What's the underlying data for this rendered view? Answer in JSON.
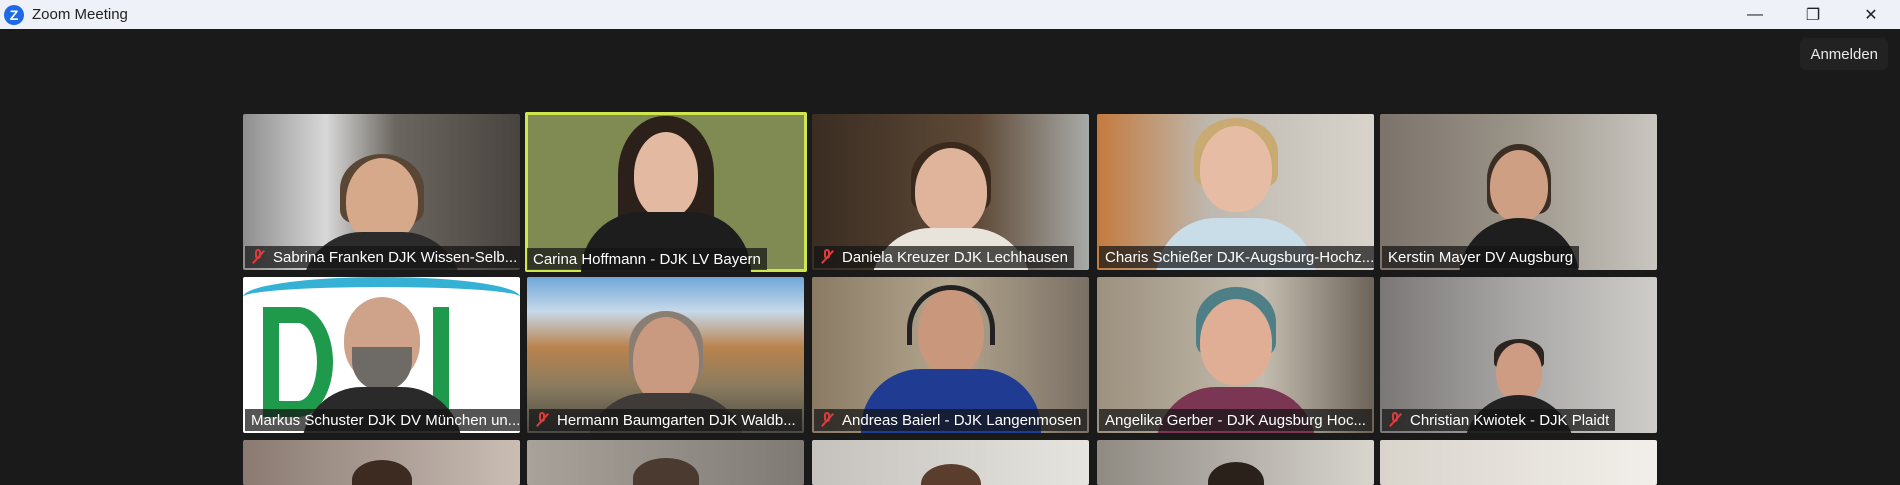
{
  "window": {
    "title": "Zoom Meeting",
    "signin_label": "Anmelden",
    "minimize_glyph": "—",
    "restore_glyph": "❐",
    "close_glyph": "✕"
  },
  "participants": [
    {
      "name": "Sabrina Franken DJK Wissen-Selb...",
      "muted": true
    },
    {
      "name": "Carina Hoffmann - DJK LV Bayern",
      "muted": false,
      "active_speaker": true
    },
    {
      "name": "Daniela Kreuzer DJK Lechhausen",
      "muted": true
    },
    {
      "name": "Charis Schießer DJK-Augsburg-Hochz...",
      "muted": false
    },
    {
      "name": "Kerstin Mayer DV Augsburg",
      "muted": false
    },
    {
      "name": "Markus Schuster DJK DV München un...",
      "muted": false
    },
    {
      "name": "Hermann Baumgarten DJK Waldb...",
      "muted": true
    },
    {
      "name": "Andreas Baierl - DJK Langenmosen",
      "muted": true
    },
    {
      "name": "Angelika Gerber - DJK Augsburg Hoc...",
      "muted": false
    },
    {
      "name": "Christian Kwiotek - DJK Plaidt",
      "muted": true
    }
  ],
  "colors": {
    "background": "#1a1a1a",
    "titlebar": "#eef1f7",
    "active_speaker_border": "#cfe64e",
    "muted_icon": "#e23b3b",
    "zoom_blue": "#1e6ae6"
  }
}
